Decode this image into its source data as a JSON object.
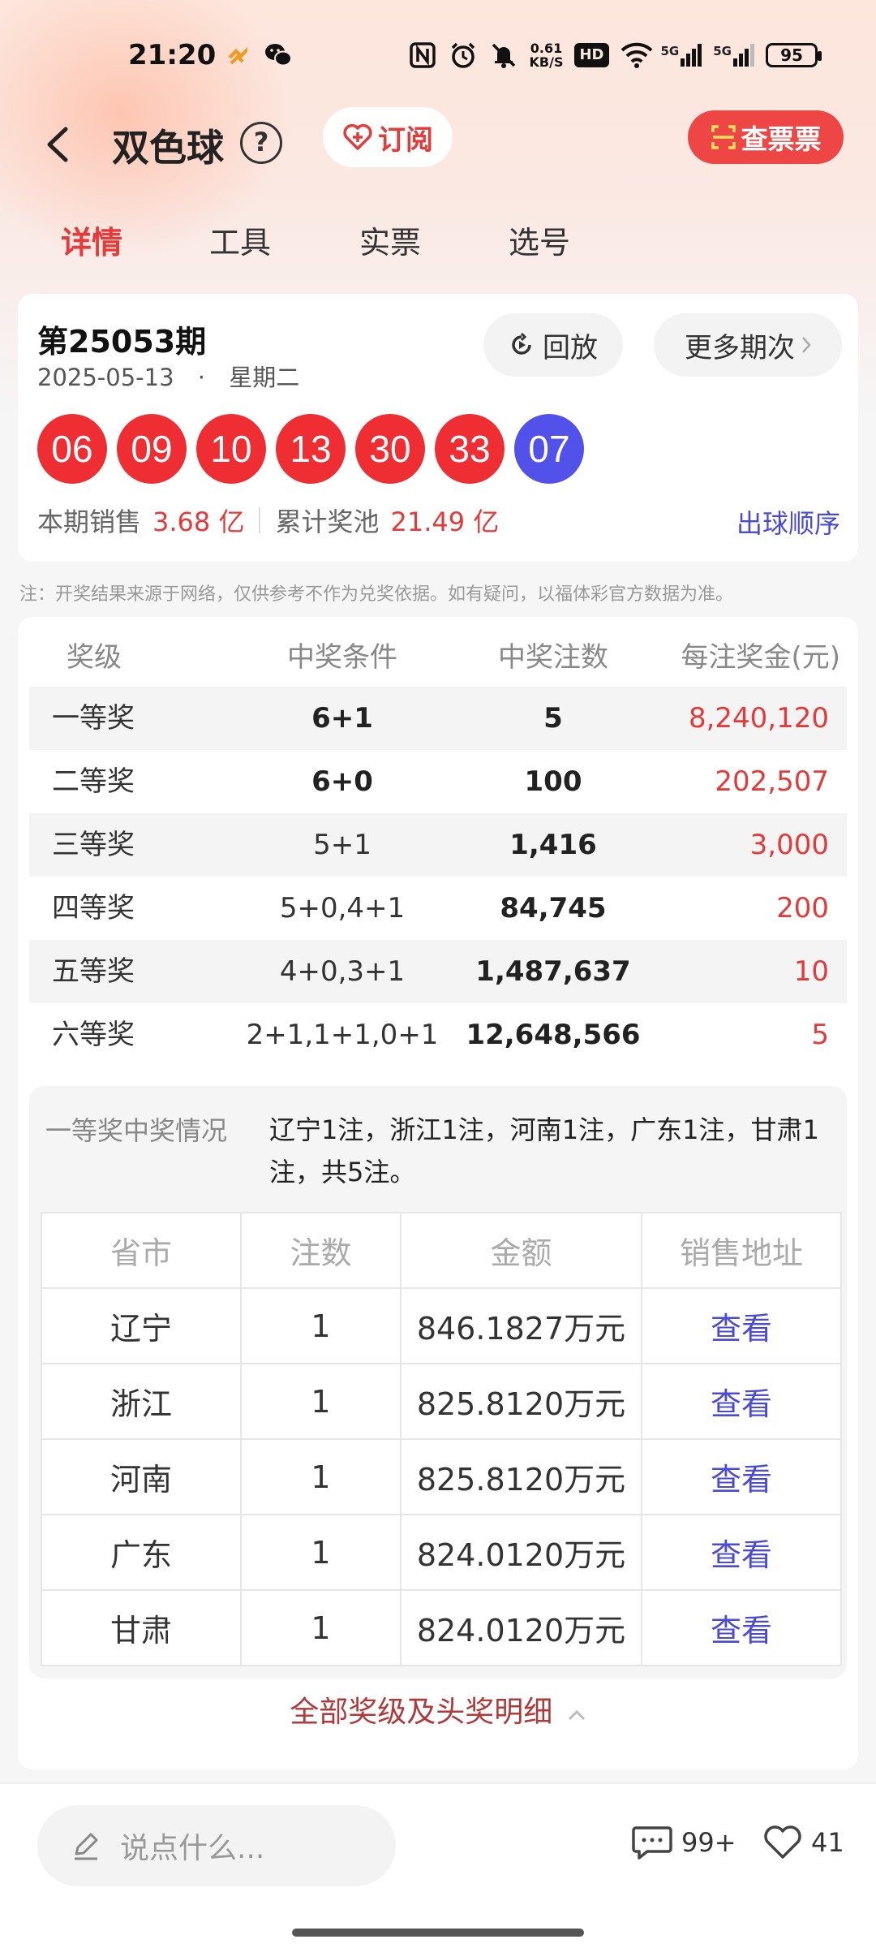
{
  "status_bar": {
    "time": "21:20",
    "net_speed_value": "0.61",
    "net_speed_unit": "KB/S",
    "hd_label": "HD",
    "signal1_label": "5G",
    "signal2_label": "5G",
    "battery": "95"
  },
  "header": {
    "title": "双色球",
    "help_label": "?",
    "subscribe_label": "订阅",
    "check_ticket_label": "查票票"
  },
  "tabs": [
    {
      "label": "详情",
      "active": true
    },
    {
      "label": "工具",
      "active": false
    },
    {
      "label": "实票",
      "active": false
    },
    {
      "label": "选号",
      "active": false
    }
  ],
  "draw": {
    "issue": "第25053期",
    "date": "2025-05-13",
    "dot": "·",
    "weekday": "星期二",
    "replay_label": "回放",
    "more_issues_label": "更多期次",
    "red_balls": [
      "06",
      "09",
      "10",
      "13",
      "30",
      "33"
    ],
    "blue_ball": "07",
    "sales_label": "本期销售",
    "sales_value": "3.68 亿",
    "pool_label": "累计奖池",
    "pool_value": "21.49 亿",
    "order_link": "出球顺序"
  },
  "note": "注：开奖结果来源于网络，仅供参考不作为兑奖依据。如有疑问，以福体彩官方数据为准。",
  "prize_table": {
    "headers": [
      "奖级",
      "中奖条件",
      "中奖注数",
      "每注奖金(元)"
    ],
    "rows": [
      {
        "level": "一等奖",
        "condition": "6+1",
        "count": "5",
        "amount": "8,240,120"
      },
      {
        "level": "二等奖",
        "condition": "6+0",
        "count": "100",
        "amount": "202,507"
      },
      {
        "level": "三等奖",
        "condition": "5+1",
        "count": "1,416",
        "amount": "3,000"
      },
      {
        "level": "四等奖",
        "condition": "5+0,4+1",
        "count": "84,745",
        "amount": "200"
      },
      {
        "level": "五等奖",
        "condition": "4+0,3+1",
        "count": "1,487,637",
        "amount": "10"
      },
      {
        "level": "六等奖",
        "condition": "2+1,1+1,0+1",
        "count": "12,648,566",
        "amount": "5"
      }
    ]
  },
  "winners": {
    "label": "一等奖中奖情况",
    "summary": "辽宁1注，浙江1注，河南1注，广东1注，甘肃1注，共5注。",
    "headers": [
      "省市",
      "注数",
      "金额",
      "销售地址"
    ],
    "rows": [
      {
        "province": "辽宁",
        "count": "1",
        "amount": "846.1827万元",
        "link": "查看"
      },
      {
        "province": "浙江",
        "count": "1",
        "amount": "825.8120万元",
        "link": "查看"
      },
      {
        "province": "河南",
        "count": "1",
        "amount": "825.8120万元",
        "link": "查看"
      },
      {
        "province": "广东",
        "count": "1",
        "amount": "824.0120万元",
        "link": "查看"
      },
      {
        "province": "甘肃",
        "count": "1",
        "amount": "824.0120万元",
        "link": "查看"
      }
    ],
    "all_link": "全部奖级及头奖明细"
  },
  "bottom": {
    "comment_placeholder": "说点什么...",
    "comment_count": "99+",
    "like_count": "41"
  },
  "colors": {
    "accent_red": "#e43a3a",
    "ball_red": "#ef2e33",
    "ball_blue": "#5252ea",
    "link_blue": "#4a4ad6"
  }
}
